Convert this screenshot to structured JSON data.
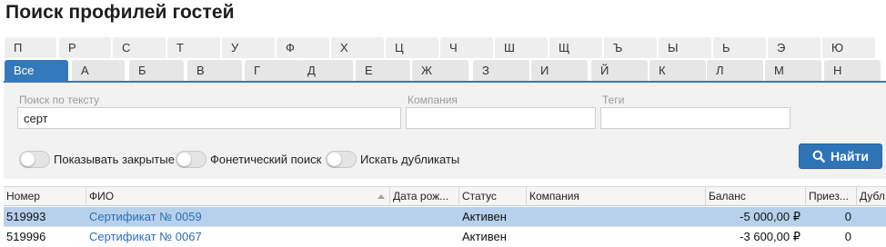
{
  "page": {
    "title": "Поиск профилей гостей"
  },
  "alphabet": {
    "row1": [
      "П",
      "Р",
      "С",
      "Т",
      "У",
      "Ф",
      "Х",
      "Ц",
      "Ч",
      "Ш",
      "Щ",
      "Ъ",
      "Ы",
      "Ь",
      "Э",
      "Ю"
    ],
    "row2": [
      "Все",
      "А",
      "Б",
      "В",
      "Г",
      "Д",
      "Е",
      "Ж",
      "З",
      "И",
      "Й",
      "К",
      "Л",
      "М",
      "Н"
    ],
    "active": "Все"
  },
  "filters": {
    "text_search": {
      "label": "Поиск по тексту",
      "value": "серт"
    },
    "company": {
      "label": "Компания",
      "value": ""
    },
    "tags": {
      "label": "Теги",
      "value": ""
    }
  },
  "toggles": {
    "show_closed": {
      "label": "Показывать закрытые",
      "on": false
    },
    "phonetic": {
      "label": "Фонетический поиск",
      "on": false
    },
    "duplicates": {
      "label": "Искать дубликаты",
      "on": false
    }
  },
  "search_button": {
    "label": "Найти",
    "icon": "search-icon"
  },
  "grid": {
    "columns": [
      "Номер",
      "ФИО",
      "Дата рож...",
      "Статус",
      "Компания",
      "Баланс",
      "Приез...",
      "Дубл"
    ],
    "sorted_column": "ФИО",
    "rows": [
      {
        "number": "519993",
        "name": "Сертификат № 0059",
        "dob": "",
        "status": "Активен",
        "company": "",
        "balance": "-5 000,00 ₽",
        "arrivals": "0",
        "selected": true
      },
      {
        "number": "519996",
        "name": "Сертификат № 0067",
        "dob": "",
        "status": "Активен",
        "company": "",
        "balance": "-3 600,00 ₽",
        "arrivals": "0",
        "selected": false
      }
    ]
  },
  "colors": {
    "accent": "#3579bd",
    "button": "#2f74b7",
    "selected_row": "#b7d1ec",
    "link": "#2a6db5"
  }
}
